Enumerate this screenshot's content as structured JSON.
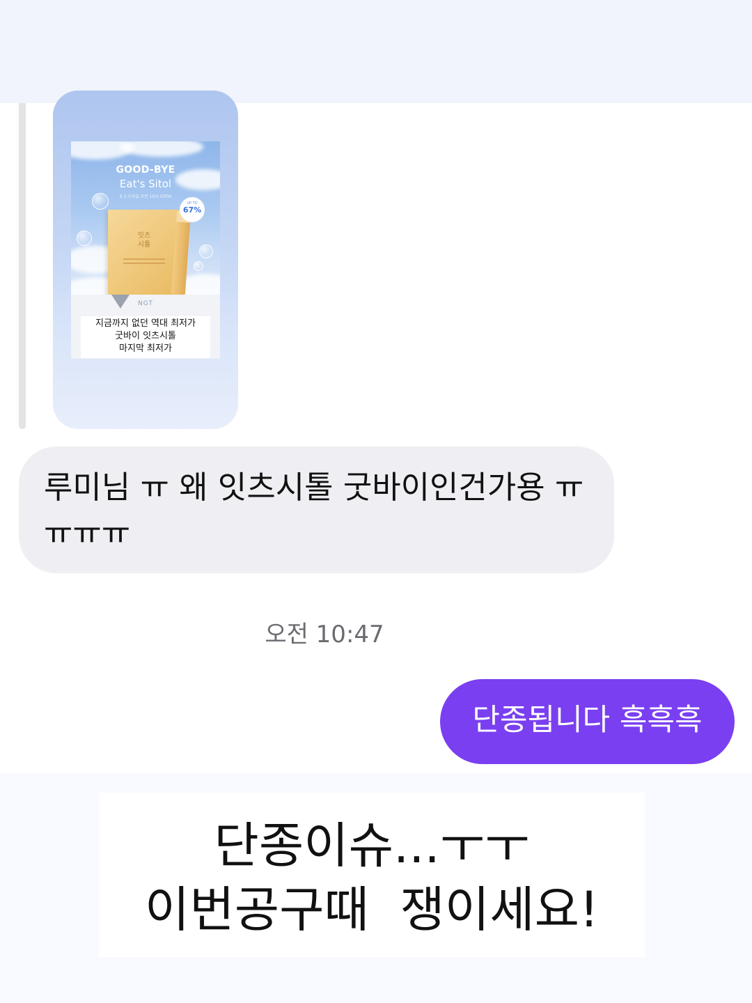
{
  "story_card": {
    "ad": {
      "headline": "GOOD-BYE",
      "product_title": "Eat's Sitol",
      "subline": "6.3 수요일 오전 10시 OPEN",
      "badge_label": "UP TO",
      "badge_value": "67%",
      "box_label": "잇츠\n시톨",
      "brand": "NGT",
      "callout": "지금까지 없던 역대 최저가\n굿바이 잇츠시톨\n마지막 최저가"
    }
  },
  "messages": {
    "incoming_text": "루미님 ㅠ 왜 잇츠시톨 굿바이인건가용 ㅠㅠㅠㅠ",
    "timestamp": "오전 10:47",
    "outgoing_text": "단종됩니다 흑흑흑"
  },
  "caption_overlay": {
    "line1": "단종이슈...ㅜㅜ",
    "line2": "이번공구때  쟁이세요!"
  },
  "colors": {
    "outgoing_bubble": "#7a3ff0",
    "incoming_bubble": "#efeff3",
    "timestamp": "#6a6a70"
  }
}
